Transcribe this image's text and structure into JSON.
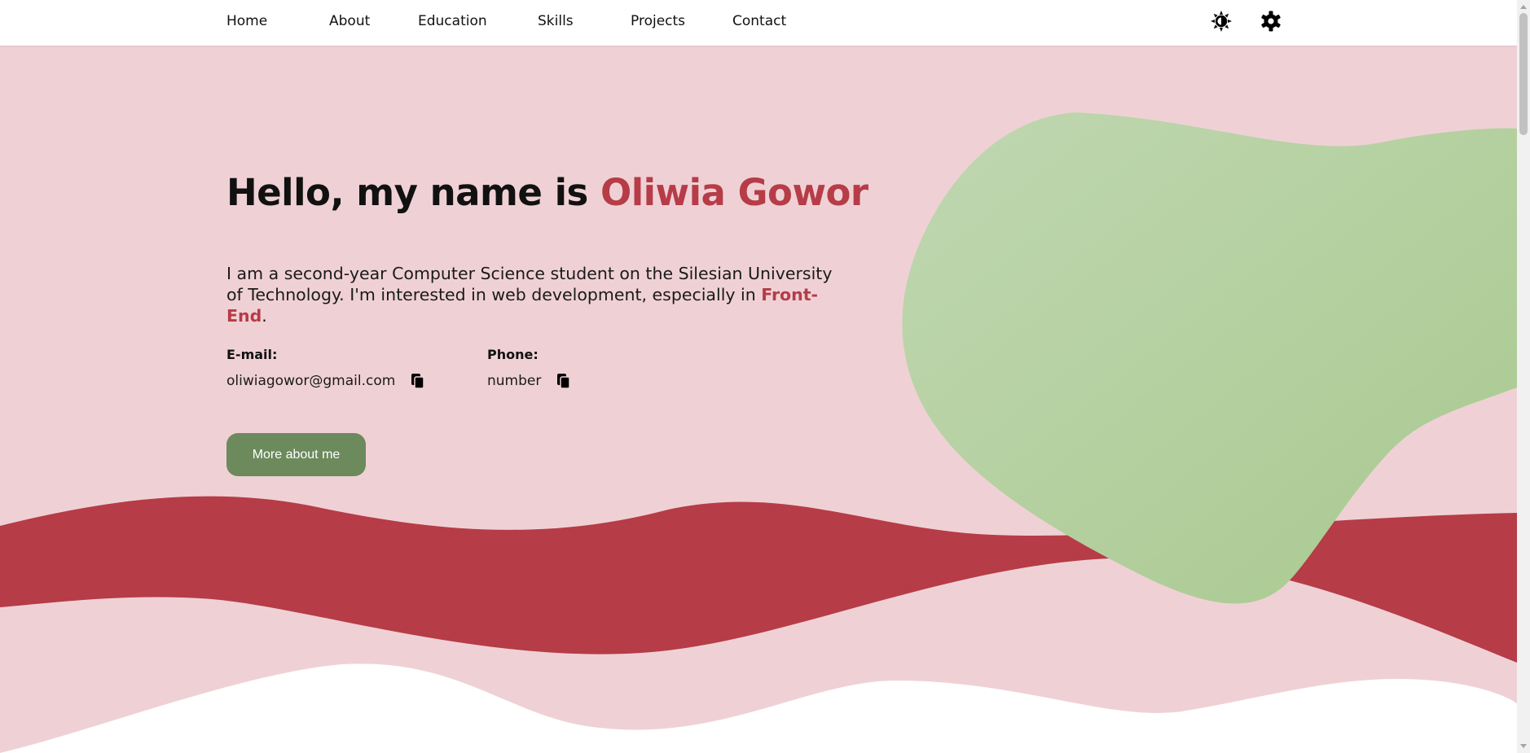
{
  "nav": {
    "items": [
      {
        "label": "Home"
      },
      {
        "label": "About"
      },
      {
        "label": "Education"
      },
      {
        "label": "Skills"
      },
      {
        "label": "Projects"
      },
      {
        "label": "Contact"
      }
    ],
    "icons": [
      "theme-toggle-icon",
      "settings-gear-icon"
    ]
  },
  "hero": {
    "title_prefix": "Hello, my name is ",
    "title_name": "Oliwia Gowor",
    "desc_main": "I am a second-year Computer Science student on the Silesian University of Technology. I'm interested in web development, especially in ",
    "desc_highlight": "Front-End",
    "desc_end": "."
  },
  "contact": {
    "email_label": "E-mail:",
    "email_value": "oliwiagowor@gmail.com",
    "phone_label": "Phone:",
    "phone_value": "number"
  },
  "buttons": {
    "more_about_me": "More about me"
  },
  "colors": {
    "background": "#efd1d5",
    "accent": "#b63c47",
    "blob": "#b3cd9b",
    "button": "#6c8a5c"
  }
}
